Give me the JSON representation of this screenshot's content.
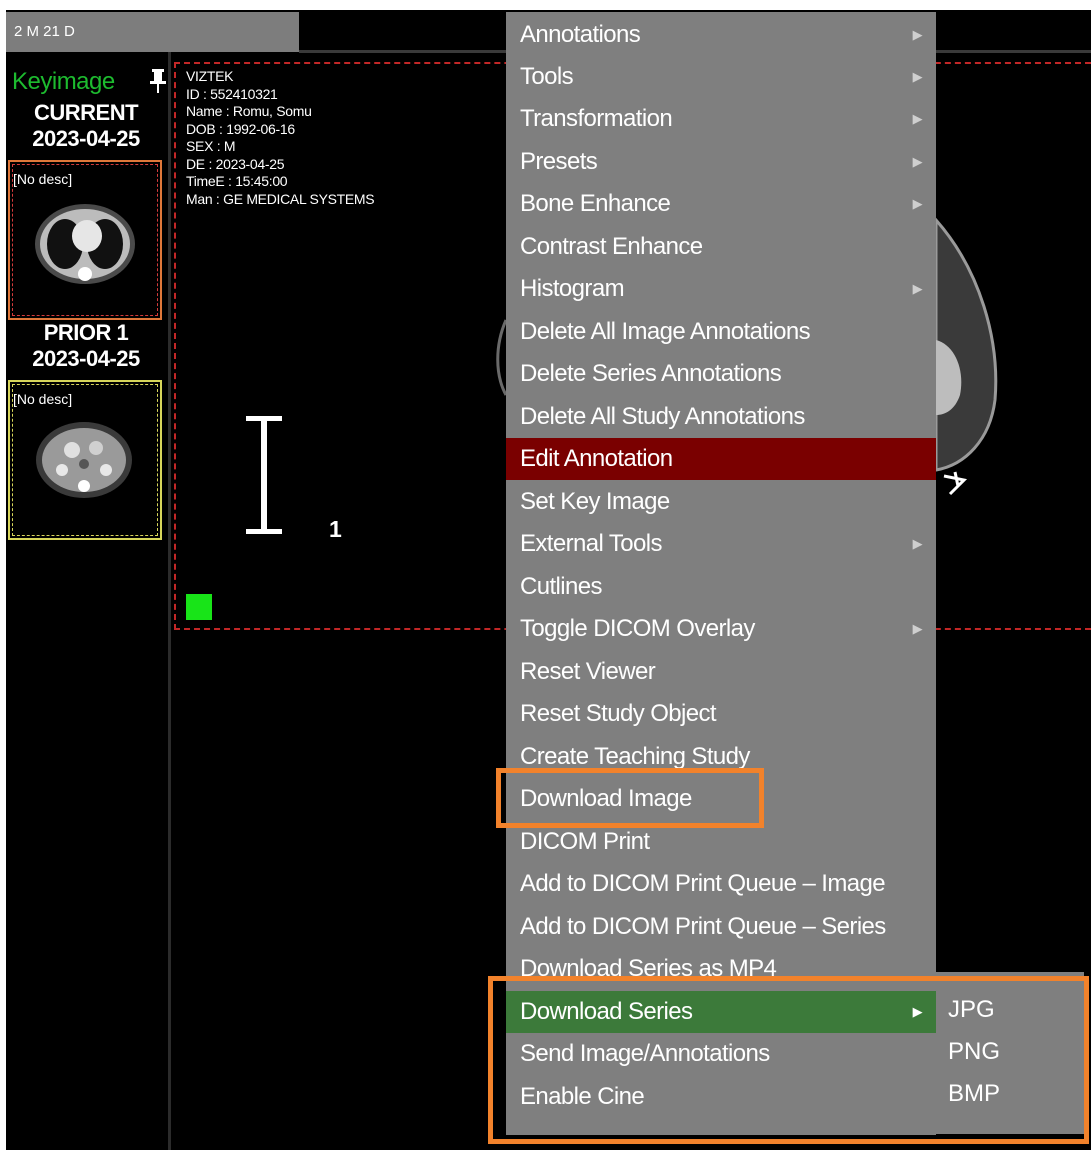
{
  "series_tab": {
    "label": "2 M 21 D"
  },
  "sidebar": {
    "keyimage_label": "Keyimage",
    "studies": [
      {
        "label": "CURRENT",
        "date": "2023-04-25",
        "thumb_desc": "[No desc]"
      },
      {
        "label": "PRIOR 1",
        "date": "2023-04-25",
        "thumb_desc": "[No desc]"
      }
    ]
  },
  "overlay": {
    "lines": [
      "VIZTEK",
      "ID : 552410321",
      "Name : Romu, Somu",
      "DOB : 1992-06-16",
      "SEX : M",
      "DE : 2023-04-25",
      "TimeE : 15:45:00",
      "Man : GE MEDICAL SYSTEMS"
    ]
  },
  "measurement_label": "1",
  "context_menu": {
    "items": [
      {
        "label": "Annotations",
        "submenu": true
      },
      {
        "label": "Tools",
        "submenu": true
      },
      {
        "label": "Transformation",
        "submenu": true
      },
      {
        "label": "Presets",
        "submenu": true
      },
      {
        "label": "Bone Enhance",
        "submenu": true
      },
      {
        "label": "Contrast Enhance",
        "submenu": false
      },
      {
        "label": "Histogram",
        "submenu": true
      },
      {
        "label": "Delete All Image Annotations",
        "submenu": false
      },
      {
        "label": "Delete Series Annotations",
        "submenu": false
      },
      {
        "label": "Delete All Study Annotations",
        "submenu": false
      },
      {
        "label": "Edit Annotation",
        "submenu": false
      },
      {
        "label": "Set Key Image",
        "submenu": false
      },
      {
        "label": "External Tools",
        "submenu": true
      },
      {
        "label": "Cutlines",
        "submenu": false
      },
      {
        "label": "Toggle DICOM Overlay",
        "submenu": true
      },
      {
        "label": "Reset Viewer",
        "submenu": false
      },
      {
        "label": "Reset Study Object",
        "submenu": false
      },
      {
        "label": "Create Teaching Study",
        "submenu": false
      },
      {
        "label": "Download Image",
        "submenu": false
      },
      {
        "label": "DICOM Print",
        "submenu": false
      },
      {
        "label": "Add to DICOM Print Queue – Image",
        "submenu": false
      },
      {
        "label": "Add to DICOM Print Queue – Series",
        "submenu": false
      },
      {
        "label": "Download Series as MP4",
        "submenu": false
      },
      {
        "label": "Download Series",
        "submenu": true
      },
      {
        "label": "Send Image/Annotations",
        "submenu": false
      },
      {
        "label": "Enable Cine",
        "submenu": false
      }
    ],
    "arrow_glyph": "▶"
  },
  "download_series_submenu": {
    "items": [
      "JPG",
      "PNG",
      "BMP"
    ]
  },
  "colors": {
    "keyimage_green": "#1dbb2f",
    "hover_red": "#7a0000",
    "active_green": "#3c7a3a",
    "highlight_orange": "#f2822b",
    "marker_green": "#18e418"
  }
}
